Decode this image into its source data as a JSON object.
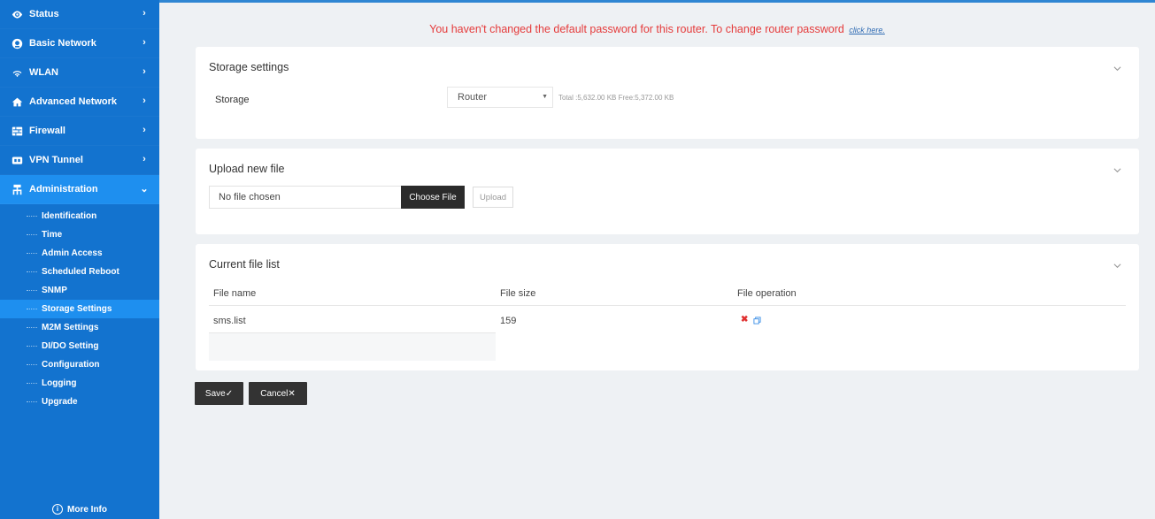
{
  "sidebar": {
    "items": [
      {
        "label": "Status",
        "icon": "eye-icon"
      },
      {
        "label": "Basic Network",
        "icon": "globe-icon"
      },
      {
        "label": "WLAN",
        "icon": "wifi-icon"
      },
      {
        "label": "Advanced Network",
        "icon": "network-icon"
      },
      {
        "label": "Firewall",
        "icon": "firewall-icon"
      },
      {
        "label": "VPN Tunnel",
        "icon": "vpn-icon"
      },
      {
        "label": "Administration",
        "icon": "admin-icon",
        "expanded": true
      }
    ],
    "subitems": [
      "Identification",
      "Time",
      "Admin Access",
      "Scheduled Reboot",
      "SNMP",
      "Storage Settings",
      "M2M Settings",
      "DI/DO Setting",
      "Configuration",
      "Logging",
      "Upgrade"
    ],
    "active_subitem": "Storage Settings",
    "more_info": "More Info",
    "colors": {
      "background": "#1373cf",
      "active": "#1e8fef"
    }
  },
  "warning": {
    "text": "You haven't changed the default password for this router. To change router password",
    "link": "click here.",
    "color": "#e53b3b"
  },
  "storage_settings": {
    "title": "Storage settings",
    "label": "Storage",
    "select_value": "Router",
    "info": "Total :5,632.00 KB Free:5,372.00 KB"
  },
  "upload": {
    "title": "Upload new file",
    "file_name": "No file chosen",
    "choose_label": "Choose File",
    "upload_label": "Upload"
  },
  "file_list": {
    "title": "Current file list",
    "columns": [
      "File name",
      "File size",
      "File operation"
    ],
    "rows": [
      {
        "name": "sms.list",
        "size": "159"
      }
    ]
  },
  "actions": {
    "save": "Save✓",
    "cancel": "Cancel✕"
  }
}
